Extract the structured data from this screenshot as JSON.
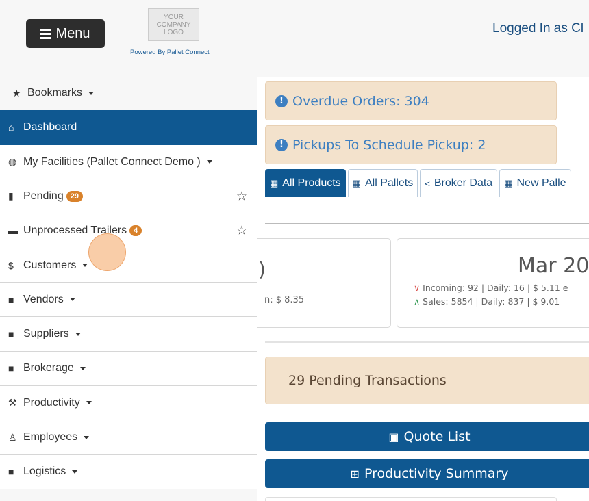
{
  "header": {
    "menu_label": "Menu",
    "logo_text": "YOUR COMPANY LOGO",
    "powered_by": "Powered By Pallet Connect",
    "logged_in": "Logged In as Cl"
  },
  "sidebar": {
    "items": [
      {
        "label": "Bookmarks",
        "icon": "star-icon"
      },
      {
        "label": "Dashboard",
        "icon": "home-icon"
      },
      {
        "label": "My Facilities (Pallet Connect Demo )",
        "icon": "globe-icon"
      },
      {
        "label": "Pending",
        "icon": "clipboard-icon",
        "badge": "29"
      },
      {
        "label": "Unprocessed Trailers",
        "icon": "trailer-icon",
        "badge": "4"
      },
      {
        "label": "Customers",
        "icon": "dollar-icon"
      },
      {
        "label": "Vendors",
        "icon": "truck-icon"
      },
      {
        "label": "Suppliers",
        "icon": "truck-icon"
      },
      {
        "label": "Brokerage",
        "icon": "truck-icon"
      },
      {
        "label": "Productivity",
        "icon": "hammer-icon"
      },
      {
        "label": "Employees",
        "icon": "person-icon"
      },
      {
        "label": "Logistics",
        "icon": "truck-icon"
      }
    ]
  },
  "alerts": {
    "overdue": "Overdue Orders: 304",
    "pickups": "Pickups To Schedule Pickup: 2"
  },
  "tabs": [
    {
      "label": "All Products"
    },
    {
      "label": "All Pallets"
    },
    {
      "label": "Broker Data"
    },
    {
      "label": "New Palle"
    }
  ],
  "cards": {
    "left_big": ")",
    "left_line": "n: $ 8.35",
    "month": "Mar 20",
    "incoming": "Incoming: 92 | Daily: 16 | $ 5.11 e",
    "sales": "Sales: 5854 | Daily: 837 | $ 9.01"
  },
  "pending_text": "29 Pending Transactions",
  "buttons": {
    "quote_list": "Quote List",
    "productivity_summary": "Productivity Summary"
  }
}
